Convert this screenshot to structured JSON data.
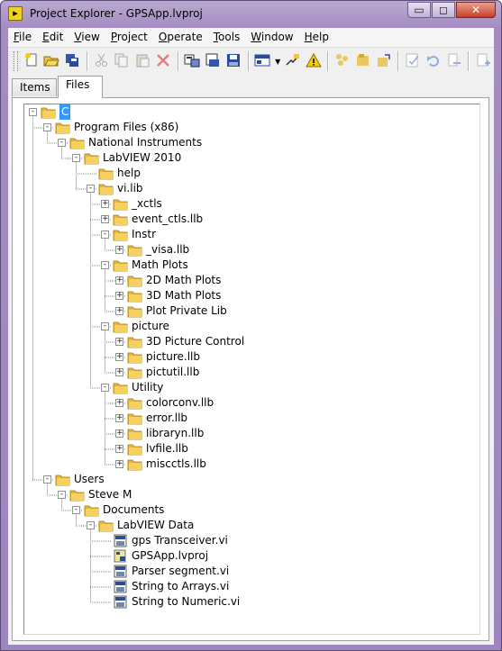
{
  "window": {
    "title": "Project Explorer - GPSApp.lvproj",
    "controls": {
      "minimize": "▭",
      "maximize": "◻",
      "close": "✕"
    }
  },
  "menu": [
    {
      "label": "File",
      "key": "F",
      "rest": "ile"
    },
    {
      "label": "Edit",
      "key": "E",
      "rest": "dit"
    },
    {
      "label": "View",
      "key": "V",
      "rest": "iew"
    },
    {
      "label": "Project",
      "key": "P",
      "rest": "roject"
    },
    {
      "label": "Operate",
      "key": "O",
      "rest": "perate"
    },
    {
      "label": "Tools",
      "key": "T",
      "rest": "ools"
    },
    {
      "label": "Window",
      "key": "W",
      "rest": "indow"
    },
    {
      "label": "Help",
      "key": "H",
      "rest": "elp"
    }
  ],
  "toolbar_icons": [
    "new-icon",
    "open-icon",
    "save-all-icon",
    "cut-icon",
    "copy-icon",
    "paste-icon",
    "delete-icon",
    "project-settings-icon",
    "build-icon",
    "save-project-icon",
    "add-items-icon",
    "arrange-icon",
    "warning-icon",
    "collapse-icon",
    "expand-icon",
    "refresh-icon",
    "check-icon",
    "undo-icon",
    "redo-icon",
    "add-file-icon"
  ],
  "tabs": {
    "items": "Items",
    "files": "Files",
    "active": "Files"
  },
  "colors": {
    "folder": "#f0c640",
    "selection": "#3399ff",
    "vi": "#2b4f8a"
  },
  "tree": [
    {
      "label": "C",
      "level": 0,
      "icon": "folder",
      "exp": "-",
      "selected": true
    },
    {
      "label": "Program Files (x86)",
      "level": 1,
      "icon": "folder",
      "exp": "-"
    },
    {
      "label": "National Instruments",
      "level": 2,
      "icon": "folder",
      "exp": "-"
    },
    {
      "label": "LabVIEW 2010",
      "level": 3,
      "icon": "folder",
      "exp": "-"
    },
    {
      "label": "help",
      "level": 4,
      "icon": "folder",
      "exp": ""
    },
    {
      "label": "vi.lib",
      "level": 4,
      "icon": "folder",
      "exp": "-"
    },
    {
      "label": "_xctls",
      "level": 5,
      "icon": "folder",
      "exp": "+"
    },
    {
      "label": "event_ctls.llb",
      "level": 5,
      "icon": "folder",
      "exp": "+"
    },
    {
      "label": "Instr",
      "level": 5,
      "icon": "folder",
      "exp": "-"
    },
    {
      "label": "_visa.llb",
      "level": 6,
      "icon": "folder",
      "exp": "+"
    },
    {
      "label": "Math Plots",
      "level": 5,
      "icon": "folder",
      "exp": "-"
    },
    {
      "label": "2D Math Plots",
      "level": 6,
      "icon": "folder",
      "exp": "+"
    },
    {
      "label": "3D Math Plots",
      "level": 6,
      "icon": "folder",
      "exp": "+"
    },
    {
      "label": "Plot Private Lib",
      "level": 6,
      "icon": "folder",
      "exp": "+"
    },
    {
      "label": "picture",
      "level": 5,
      "icon": "folder",
      "exp": "-"
    },
    {
      "label": "3D Picture Control",
      "level": 6,
      "icon": "folder",
      "exp": "+"
    },
    {
      "label": "picture.llb",
      "level": 6,
      "icon": "folder",
      "exp": "+"
    },
    {
      "label": "pictutil.llb",
      "level": 6,
      "icon": "folder",
      "exp": "+"
    },
    {
      "label": "Utility",
      "level": 5,
      "icon": "folder",
      "exp": "-"
    },
    {
      "label": "colorconv.llb",
      "level": 6,
      "icon": "folder",
      "exp": "+"
    },
    {
      "label": "error.llb",
      "level": 6,
      "icon": "folder",
      "exp": "+"
    },
    {
      "label": "libraryn.llb",
      "level": 6,
      "icon": "folder",
      "exp": "+"
    },
    {
      "label": "lvfile.llb",
      "level": 6,
      "icon": "folder",
      "exp": "+"
    },
    {
      "label": "miscctls.llb",
      "level": 6,
      "icon": "folder",
      "exp": "+"
    },
    {
      "label": "Users",
      "level": 1,
      "icon": "folder",
      "exp": "-"
    },
    {
      "label": "Steve M",
      "level": 2,
      "icon": "folder",
      "exp": "-"
    },
    {
      "label": "Documents",
      "level": 3,
      "icon": "folder",
      "exp": "-"
    },
    {
      "label": "LabVIEW Data",
      "level": 4,
      "icon": "folder",
      "exp": "-"
    },
    {
      "label": "gps Transceiver.vi",
      "level": 5,
      "icon": "vi",
      "exp": ""
    },
    {
      "label": "GPSApp.lvproj",
      "level": 5,
      "icon": "project",
      "exp": ""
    },
    {
      "label": "Parser segment.vi",
      "level": 5,
      "icon": "vi",
      "exp": ""
    },
    {
      "label": "String to Arrays.vi",
      "level": 5,
      "icon": "vi",
      "exp": ""
    },
    {
      "label": "String to Numeric.vi",
      "level": 5,
      "icon": "vi",
      "exp": ""
    }
  ]
}
